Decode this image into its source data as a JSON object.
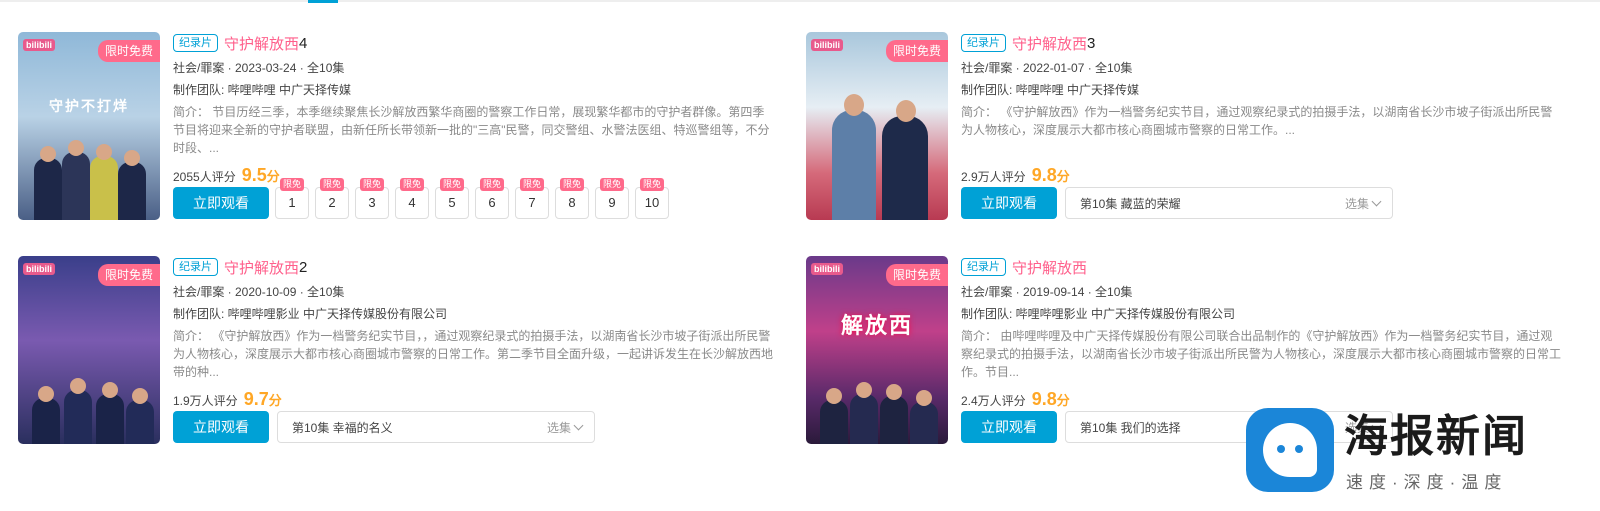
{
  "cards": [
    {
      "tag": "纪录片",
      "title": "守护解放西",
      "title_num": "4",
      "meta": "社会/罪案 · 2023-03-24 · 全10集",
      "producer": "制作团队: 哔哩哔哩 中广天择传媒",
      "description": "简介：  节目历经三季，本季继续聚焦长沙解放西繁华商圈的警察工作日常，展现繁华都市的守护者群像。第四季节目将迎来全新的守护者联盟，由新任所长带领新一批的\"三高\"民警，同交警组、水警法医组、特巡警组等，不分时段、...",
      "rating_count": "2055人评分",
      "rating_score": "9.5",
      "rating_unit": "分",
      "poster_badge": "限时免费",
      "poster_logo": "bilibili",
      "poster_art": "守护不打烊",
      "watch_label": "立即观看",
      "episodes": [
        "1",
        "2",
        "3",
        "4",
        "5",
        "6",
        "7",
        "8",
        "9",
        "10"
      ],
      "episode_badge": "限免"
    },
    {
      "tag": "纪录片",
      "title": "守护解放西",
      "title_num": "3",
      "meta": "社会/罪案 · 2022-01-07 · 全10集",
      "producer": "制作团队: 哔哩哔哩 中广天择传媒",
      "description": "简介：  《守护解放西》作为一档警务纪实节目，通过观察纪录式的拍摄手法，以湖南省长沙市坡子街派出所民警为人物核心，深度展示大都市核心商圈城市警察的日常工作。...",
      "rating_count": "2.9万人评分",
      "rating_score": "9.8",
      "rating_unit": "分",
      "poster_badge": "限时免费",
      "poster_logo": "bilibili",
      "poster_art": "",
      "watch_label": "立即观看",
      "selected_episode": "第10集 藏蓝的荣耀",
      "select_label": "选集"
    },
    {
      "tag": "纪录片",
      "title": "守护解放西",
      "title_num": "2",
      "meta": "社会/罪案 · 2020-10-09 · 全10集",
      "producer": "制作团队: 哔哩哔哩影业 中广天择传媒股份有限公司",
      "description": "简介：  《守护解放西》作为一档警务纪实节目，，通过观察纪录式的拍摄手法，以湖南省长沙市坡子街派出所民警为人物核心，深度展示大都市核心商圈城市警察的日常工作。第二季节目全面升级，一起讲诉发生在长沙解放西地带的种...",
      "rating_count": "1.9万人评分",
      "rating_score": "9.7",
      "rating_unit": "分",
      "poster_badge": "限时免费",
      "poster_logo": "bilibili",
      "poster_art": "",
      "watch_label": "立即观看",
      "selected_episode": "第10集 幸福的名义",
      "select_label": "选集"
    },
    {
      "tag": "纪录片",
      "title": "守护解放西",
      "title_num": "",
      "meta": "社会/罪案 · 2019-09-14 · 全10集",
      "producer": "制作团队: 哔哩哔哩影业 中广天择传媒股份有限公司",
      "description": "简介：  由哔哩哔哩及中广天择传媒股份有限公司联合出品制作的《守护解放西》作为一档警务纪实节目，通过观察纪录式的拍摄手法，以湖南省长沙市坡子街派出所民警为人物核心，深度展示大都市核心商圈城市警察的日常工作。节目...",
      "rating_count": "2.4万人评分",
      "rating_score": "9.8",
      "rating_unit": "分",
      "poster_badge": "限时免费",
      "poster_logo": "bilibili",
      "poster_art": "解放西",
      "watch_label": "立即观看",
      "selected_episode": "第10集 我们的选择",
      "select_label": "选集"
    }
  ],
  "watermark": {
    "name": "海报新闻",
    "tagline": "速度·深度·温度",
    "icon": "seal-mascot-icon"
  },
  "colors": {
    "accent": "#00a1d6",
    "title_pink": "#ff5f8b",
    "score_orange": "#ffa726",
    "badge_pink": "#ff6a8b"
  }
}
